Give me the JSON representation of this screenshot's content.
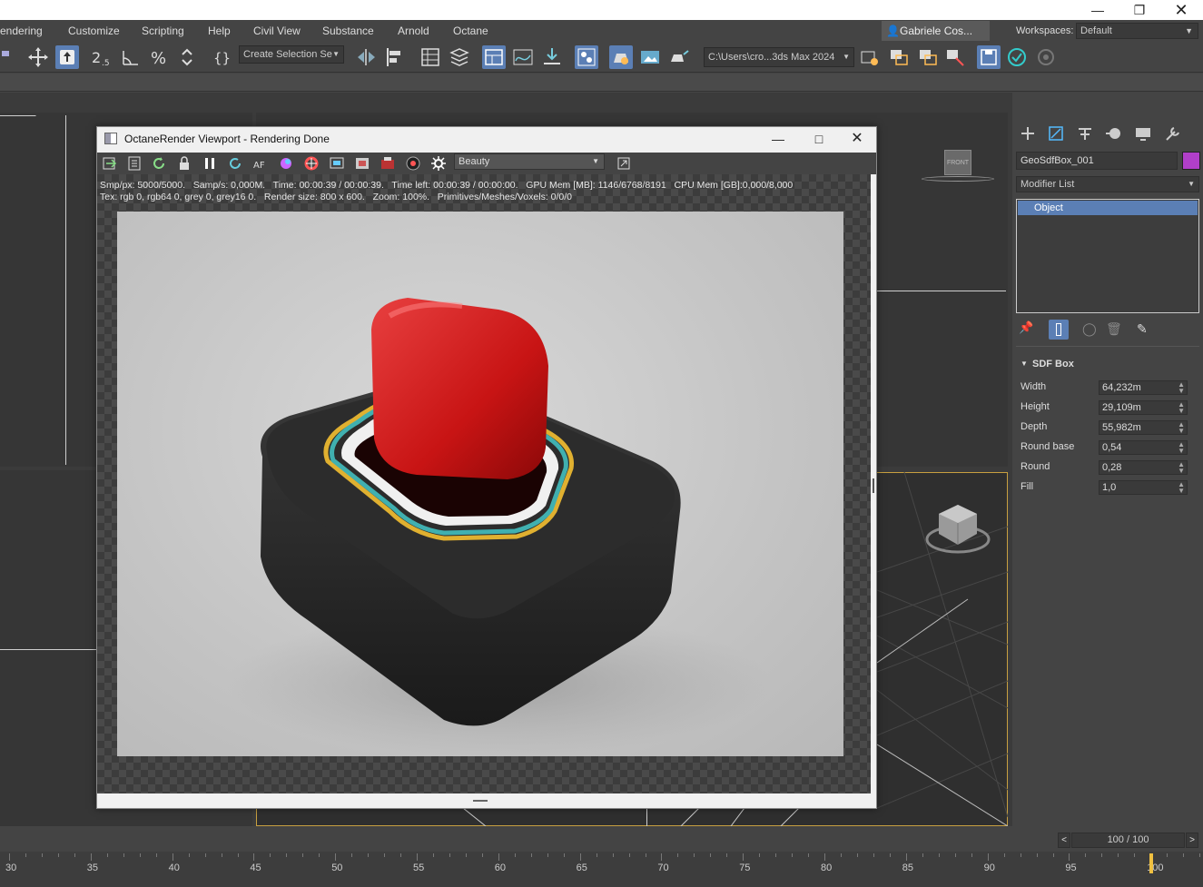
{
  "window": {
    "menu": [
      "endering",
      "Customize",
      "Scripting",
      "Help",
      "Civil View",
      "Substance",
      "Arnold",
      "Octane"
    ],
    "user": "Gabriele Cos...",
    "workspaces_label": "Workspaces:",
    "workspace": "Default"
  },
  "toolbar": {
    "selection_set": "Create Selection Se",
    "project_path": "C:\\Users\\cro...3ds Max 2024"
  },
  "octane": {
    "title": "OctaneRender Viewport - Rendering Done",
    "pass": "Beauty",
    "stats_line1": "Smp/px: 5000/5000.   Samp/s: 0,000M.   Time: 00:00:39 / 00:00:39.   Time left: 00:00:39 / 00:00:00.   GPU Mem [MB]: 1146/6768/8191   CPU Mem [GB]:0,000/8,000",
    "stats_line2": "Tex: rgb 0, rgb64 0, grey 0, grey16 0.   Render size: 800 x 600.   Zoom: 100%.   Primitives/Meshes/Voxels: 0/0/0"
  },
  "command_panel": {
    "object_name": "GeoSdfBox_001",
    "object_color": "#b13fc9",
    "modifier_list": "Modifier List",
    "stack_item": "Object",
    "rollout_title": "SDF Box",
    "params": [
      {
        "label": "Width",
        "value": "64,232m"
      },
      {
        "label": "Height",
        "value": "29,109m"
      },
      {
        "label": "Depth",
        "value": "55,982m"
      },
      {
        "label": "Round base",
        "value": "0,54"
      },
      {
        "label": "Round",
        "value": "0,28"
      },
      {
        "label": "Fill",
        "value": "1,0"
      }
    ]
  },
  "viewcube": {
    "front_label": "FRONT"
  },
  "timeline": {
    "frame": "100 / 100",
    "ticks": [
      "30",
      "35",
      "40",
      "45",
      "50",
      "55",
      "60",
      "65",
      "70",
      "75",
      "80",
      "85",
      "90",
      "95",
      "100"
    ]
  },
  "colors": {
    "accent": "#5b7fb5",
    "active_viewport_border": "#c8a040"
  }
}
